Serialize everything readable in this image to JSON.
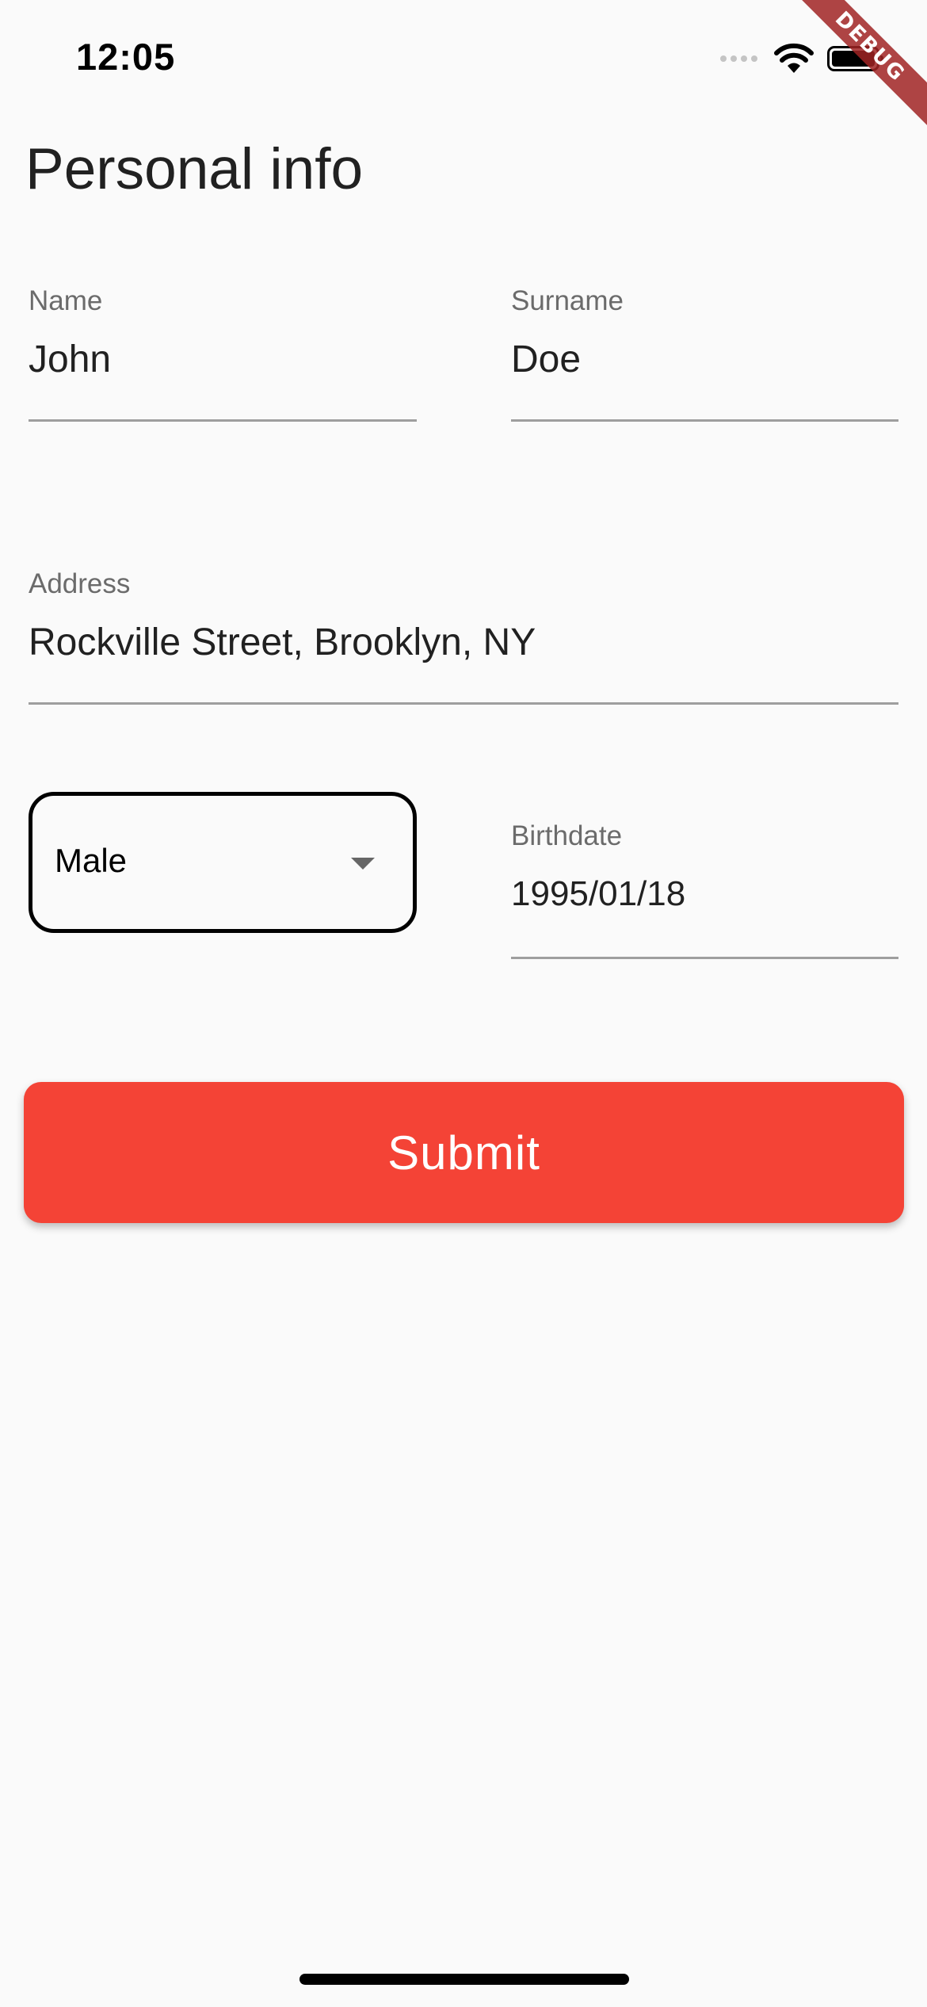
{
  "status_bar": {
    "time": "12:05",
    "icons": [
      "signal-icon",
      "wifi-icon",
      "battery-icon"
    ]
  },
  "debug_banner": {
    "label": "DEBUG"
  },
  "page": {
    "title": "Personal info"
  },
  "form": {
    "name": {
      "label": "Name",
      "value": "John"
    },
    "surname": {
      "label": "Surname",
      "value": "Doe"
    },
    "address": {
      "label": "Address",
      "value": "Rockville Street, Brooklyn, NY"
    },
    "gender": {
      "selected": "Male",
      "icon": "dropdown-arrow-icon"
    },
    "birthdate": {
      "label": "Birthdate",
      "value": "1995/01/18"
    }
  },
  "actions": {
    "submit_label": "Submit"
  },
  "colors": {
    "background": "#fafafa",
    "primary_button": "#f44336",
    "underline": "#9e9e9e",
    "label_text": "#6b6b6b",
    "debug_banner": "#a02323"
  }
}
